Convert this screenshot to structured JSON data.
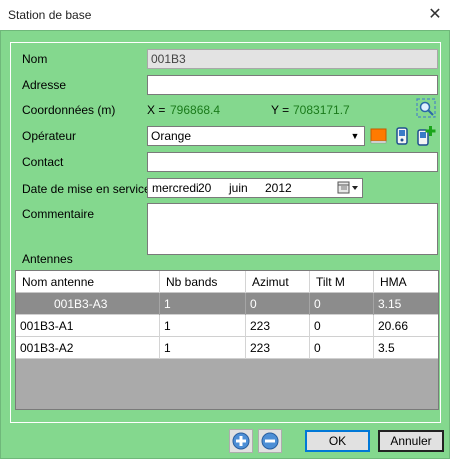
{
  "window": {
    "title": "Station de base",
    "close": "✕"
  },
  "form": {
    "nom_label": "Nom",
    "nom_value": "001B3",
    "adresse_label": "Adresse",
    "adresse_value": "",
    "coord_label": "Coordonnées (m)",
    "x_label": "X =",
    "x_value": "796868.4",
    "y_label": "Y =",
    "y_value": "7083171.7",
    "operateur_label": "Opérateur",
    "operateur_value": "Orange",
    "contact_label": "Contact",
    "contact_value": "",
    "date_label": "Date de mise en service",
    "date_weekday": "mercredi",
    "date_day": "20",
    "date_month": "juin",
    "date_year": "2012",
    "commentaire_label": "Commentaire",
    "commentaire_value": "",
    "antennes_label": "Antennes"
  },
  "colors": {
    "operator_swatch": "#ff7a00",
    "background": "#84d88e",
    "coord_text": "#1a7a1a"
  },
  "icons": {
    "locate": "magnifier-target-icon",
    "operator_color": "orange-color-icon",
    "operator_edit": "phone-edit-icon",
    "operator_add": "phone-add-icon",
    "calendar": "calendar-icon",
    "add_antenna": "plus-circle-icon",
    "remove_antenna": "minus-circle-icon"
  },
  "table": {
    "headers": [
      "Nom antenne",
      "Nb bands",
      "Azimut",
      "Tilt M",
      "HMA"
    ],
    "rows": [
      [
        "001B3-A3",
        "1",
        "0",
        "0",
        "3.15"
      ],
      [
        "001B3-A1",
        "1",
        "223",
        "0",
        "20.66"
      ],
      [
        "001B3-A2",
        "1",
        "223",
        "0",
        "3.5"
      ]
    ]
  },
  "buttons": {
    "ok": "OK",
    "cancel": "Annuler"
  }
}
